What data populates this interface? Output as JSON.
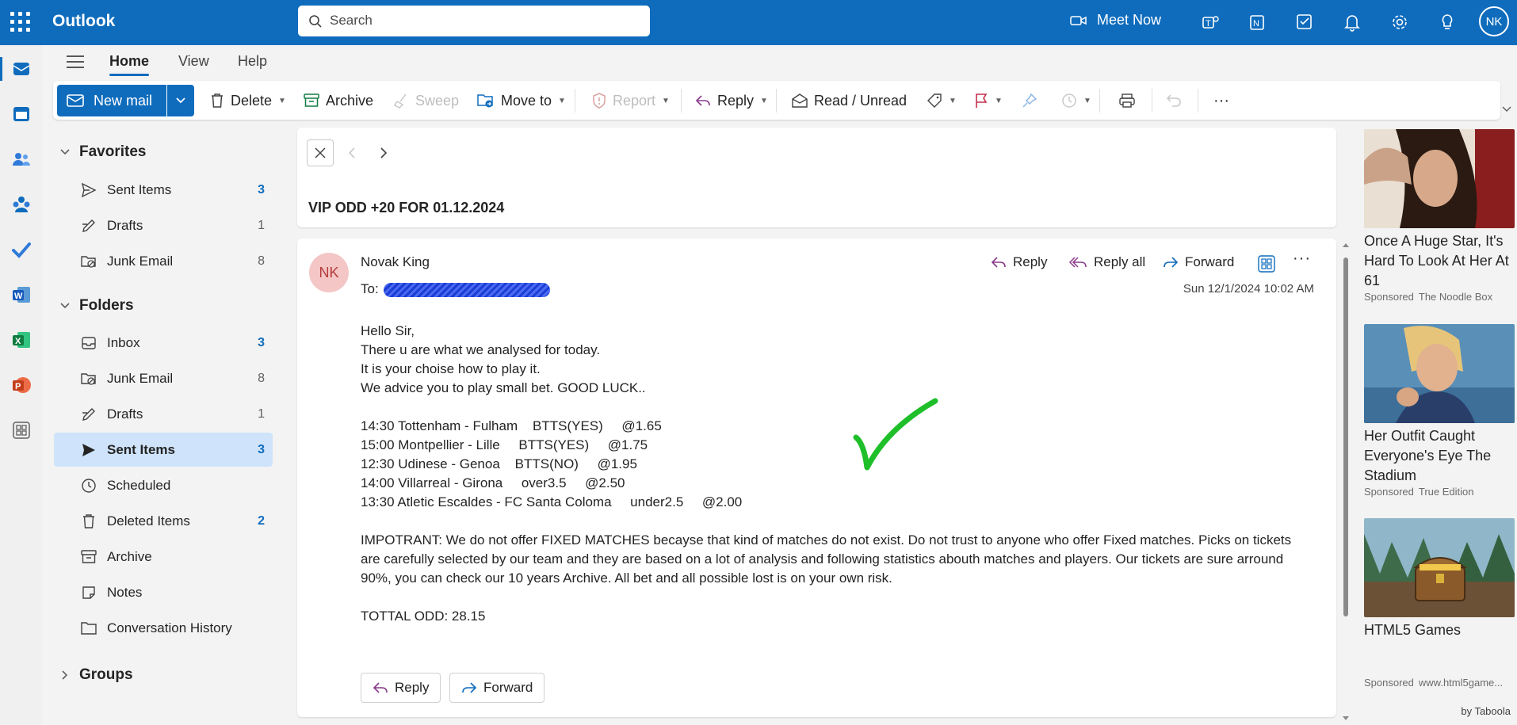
{
  "app": {
    "name": "Outlook",
    "user_initials": "NK"
  },
  "search": {
    "placeholder": "Search"
  },
  "topbar": {
    "meet_now": "Meet Now"
  },
  "menu_tabs": [
    "Home",
    "View",
    "Help"
  ],
  "ribbon": {
    "new_mail": "New mail",
    "delete": "Delete",
    "archive": "Archive",
    "sweep": "Sweep",
    "move_to": "Move to",
    "report": "Report",
    "reply": "Reply",
    "read_unread": "Read / Unread"
  },
  "nav": {
    "favorites_label": "Favorites",
    "favorites": [
      {
        "label": "Sent Items",
        "count": "3"
      },
      {
        "label": "Drafts",
        "count": "1"
      },
      {
        "label": "Junk Email",
        "count": "8"
      }
    ],
    "folders_label": "Folders",
    "folders": [
      {
        "label": "Inbox",
        "count": "3"
      },
      {
        "label": "Junk Email",
        "count": "8"
      },
      {
        "label": "Drafts",
        "count": "1"
      },
      {
        "label": "Sent Items",
        "count": "3"
      },
      {
        "label": "Scheduled",
        "count": ""
      },
      {
        "label": "Deleted Items",
        "count": "2"
      },
      {
        "label": "Archive",
        "count": ""
      },
      {
        "label": "Notes",
        "count": ""
      },
      {
        "label": "Conversation History",
        "count": ""
      }
    ],
    "groups_label": "Groups"
  },
  "message": {
    "subject": "VIP ODD +20 FOR 01.12.2024",
    "sender_initials": "NK",
    "sender": "Novak King",
    "to_label": "To:",
    "date": "Sun 12/1/2024 10:02 AM",
    "reply": "Reply",
    "reply_all": "Reply all",
    "forward": "Forward",
    "body": "Hello Sir,\nThere u are what we analysed for today.\nIt is your choise how to play it.\nWe advice you to play small bet. GOOD LUCK..\n\n14:30 Tottenham - Fulham    BTTS(YES)     @1.65\n15:00 Montpellier - Lille     BTTS(YES)     @1.75\n12:30 Udinese - Genoa    BTTS(NO)     @1.95\n14:00 Villarreal - Girona     over3.5     @2.50\n13:30 Atletic Escaldes - FC Santa Coloma     under2.5     @2.00\n\nIMPOTRANT: We do not offer FIXED MATCHES becayse that kind of matches do not exist. Do not trust to anyone who offer Fixed matches. Picks on tickets are carefully selected by our team and they are based on a lot of analysis and following statistics abouth matches and players. Our tickets are sure arround 90%, you can check our 10 years Archive. All bet and all possible lost is on your own risk.\n\nTOTTAL ODD: 28.15"
  },
  "ads": [
    {
      "title": "Once A Huge Star, It's Hard To Look At Her At 61",
      "sponsored": "Sponsored",
      "source": "The Noodle Box"
    },
    {
      "title": "Her Outfit Caught Everyone's Eye The Stadium",
      "sponsored": "Sponsored",
      "source": "True Edition"
    },
    {
      "title": "HTML5 Games",
      "sponsored": "Sponsored",
      "source": "www.html5game..."
    }
  ],
  "ads_footer": "by Taboola",
  "colors": {
    "brand": "#0f6cbd",
    "selected": "#cfe4fa",
    "check": "#1fbf2a"
  }
}
